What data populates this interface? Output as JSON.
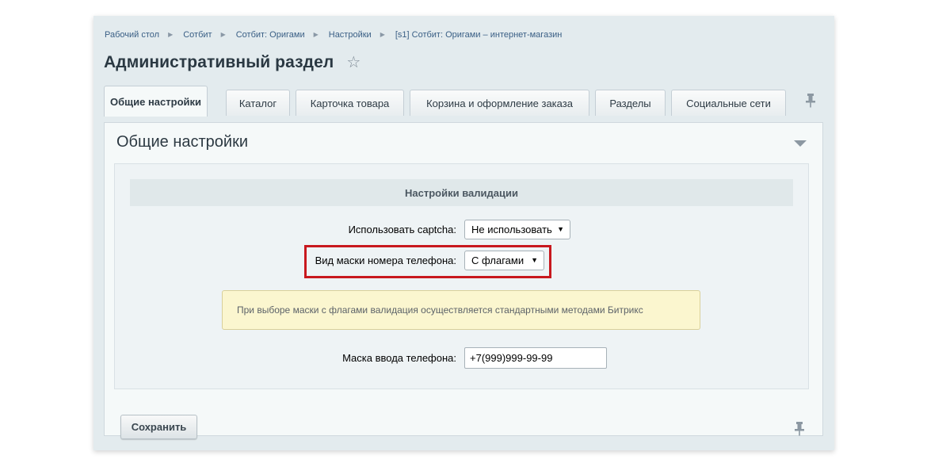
{
  "breadcrumb": {
    "items": [
      "Рабочий стол",
      "Сотбит",
      "Сотбит: Оригами",
      "Настройки",
      "[s1] Сотбит: Оригами – интернет-магазин"
    ]
  },
  "page": {
    "title": "Административный раздел"
  },
  "tabs": {
    "general": "Общие настройки",
    "catalog": "Каталог",
    "product_card": "Карточка товара",
    "cart": "Корзина и оформление заказа",
    "sections": "Разделы",
    "social": "Социальные сети"
  },
  "section": {
    "title": "Общие настройки"
  },
  "validation": {
    "header": "Настройки валидации",
    "captcha_label": "Использовать captcha:",
    "captcha_value": "Не использовать",
    "mask_type_label": "Вид маски номера телефона:",
    "mask_type_value": "С флагами",
    "note": "При выборе маски с флагами валидация осуществляется стандартными методами Битрикс",
    "phone_mask_label": "Маска ввода телефона:",
    "phone_mask_value": "+7(999)999-99-99"
  },
  "actions": {
    "save": "Сохранить"
  },
  "colors": {
    "highlight": "#c8181e",
    "note_bg": "#fbf6cf",
    "link": "#3a5f85"
  }
}
